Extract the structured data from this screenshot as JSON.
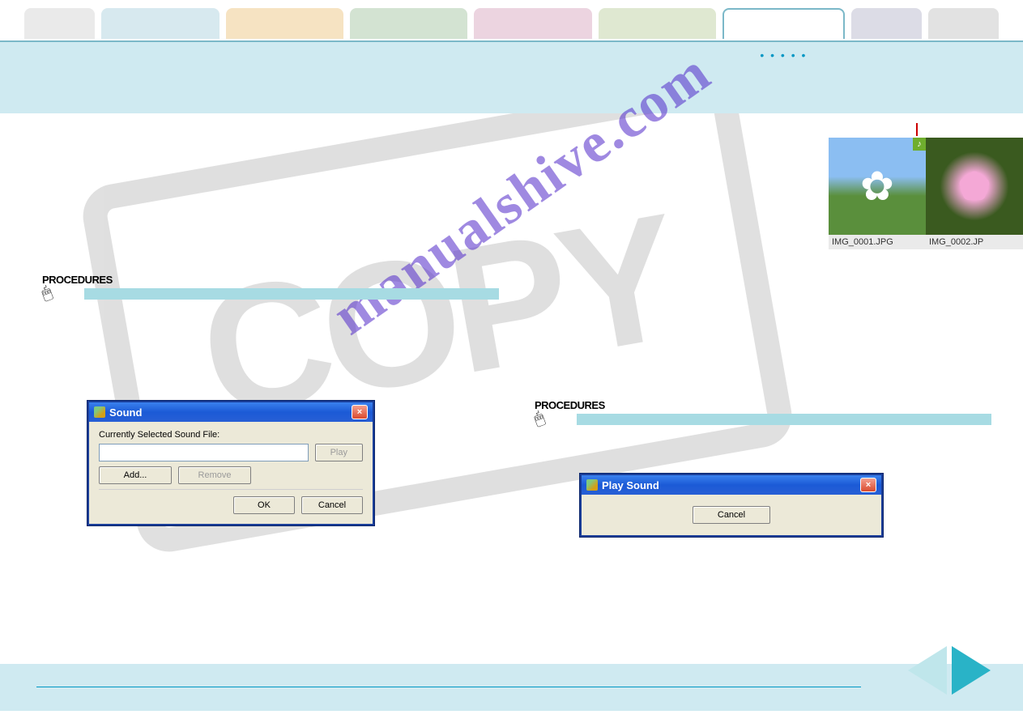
{
  "tabs": {
    "colors": [
      "#eaeaea",
      "#d7e9ef",
      "#f6e3c2",
      "#d3e3d2",
      "#ecd4e0",
      "#dfe8d1",
      "#ffffff",
      "#dcdce6",
      "#e2e2e2"
    ]
  },
  "watermark": {
    "stamp": "COPY",
    "url": "manualshive.com"
  },
  "thumbs": {
    "one": {
      "name": "IMG_0001.JPG"
    },
    "two": {
      "name": "IMG_0002.JP"
    },
    "badge": "♪"
  },
  "proc_label": "PROCEDURES",
  "dialog_sound": {
    "title": "Sound",
    "field_label": "Currently Selected Sound File:",
    "value": "",
    "play": "Play",
    "add": "Add...",
    "remove": "Remove",
    "ok": "OK",
    "cancel": "Cancel",
    "close": "×"
  },
  "dialog_play": {
    "title": "Play Sound",
    "cancel": "Cancel",
    "close": "×"
  }
}
